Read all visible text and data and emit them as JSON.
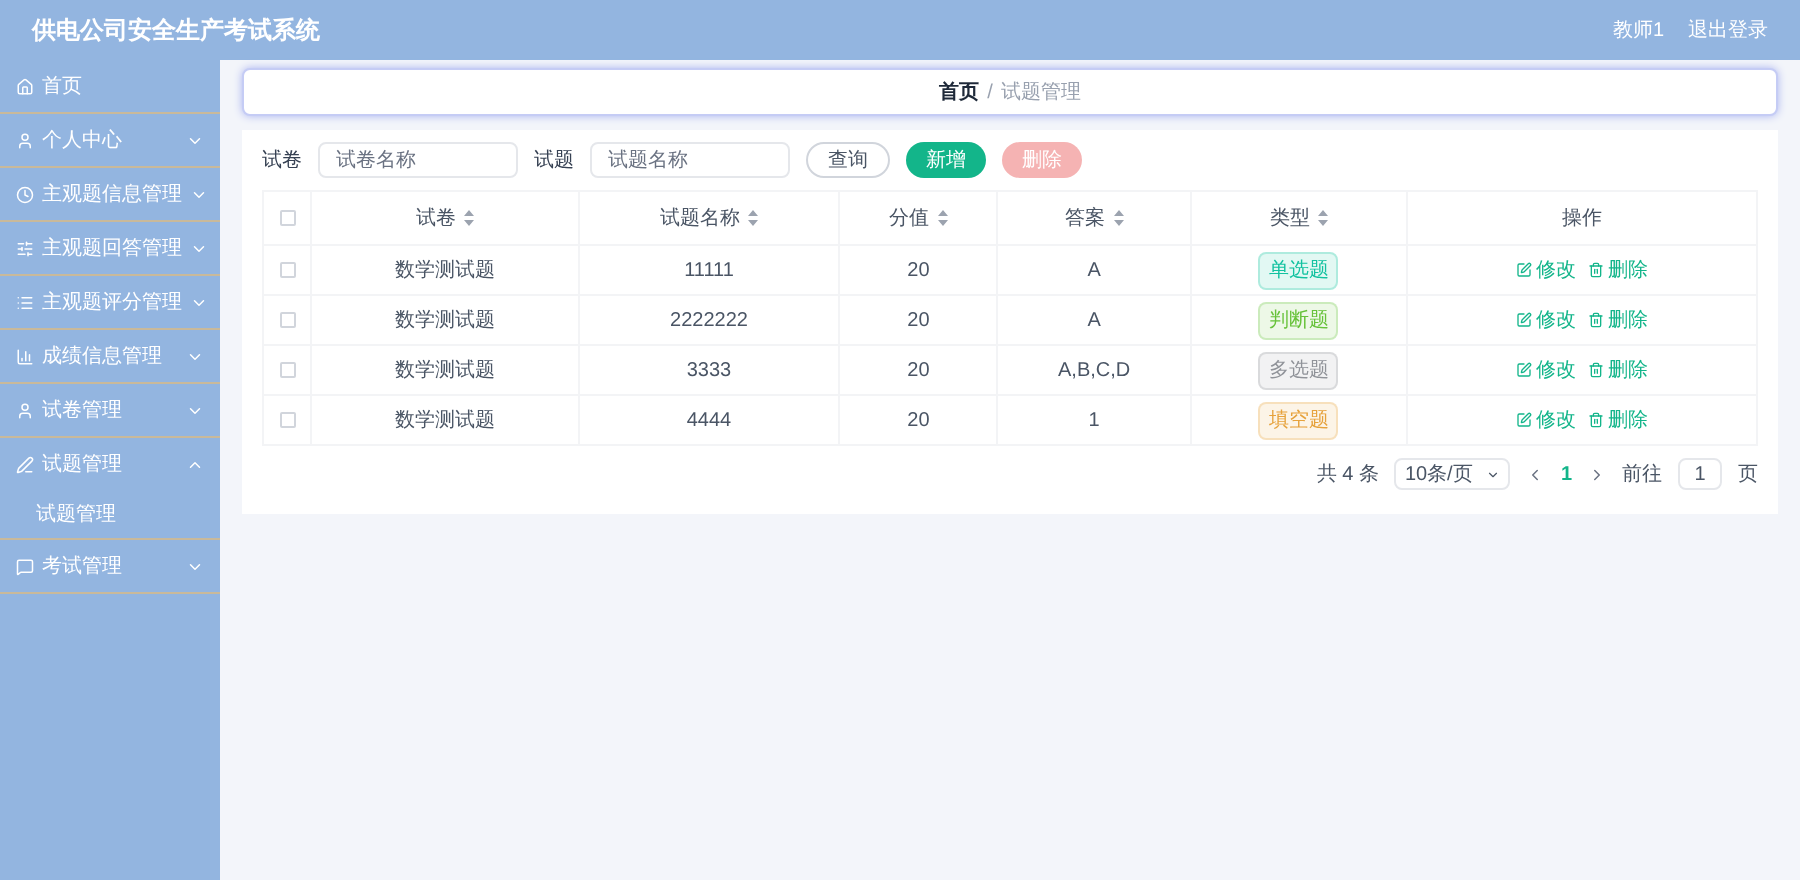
{
  "header": {
    "title": "供电公司安全生产考试系统",
    "user": "教师1",
    "logout": "退出登录"
  },
  "sidebar": {
    "items": [
      {
        "kind": "link",
        "label": "首页"
      },
      {
        "kind": "menu",
        "label": "个人中心",
        "expanded": false
      },
      {
        "kind": "menu",
        "label": "主观题信息管理",
        "expanded": false
      },
      {
        "kind": "menu",
        "label": "主观题回答管理",
        "expanded": false
      },
      {
        "kind": "menu",
        "label": "主观题评分管理",
        "expanded": false
      },
      {
        "kind": "menu",
        "label": "成绩信息管理",
        "expanded": false
      },
      {
        "kind": "menu",
        "label": "试卷管理",
        "expanded": false
      },
      {
        "kind": "menu",
        "label": "试题管理",
        "expanded": true,
        "children": [
          {
            "label": "试题管理"
          }
        ]
      },
      {
        "kind": "menu",
        "label": "考试管理",
        "expanded": false
      }
    ]
  },
  "breadcrumb": [
    "首页",
    "/",
    "试题管理"
  ],
  "search": {
    "fields": [
      {
        "label": "试卷",
        "placeholder": "试卷名称"
      },
      {
        "label": "试题",
        "placeholder": "试题名称"
      }
    ],
    "buttons": [
      {
        "kind": "outline",
        "label": "查询"
      },
      {
        "kind": "primary",
        "label": "新增"
      },
      {
        "kind": "danger",
        "label": "删除"
      }
    ]
  },
  "table": {
    "select_all": {
      "checked": false
    },
    "columns": [
      {
        "label": "试卷",
        "sortable": true
      },
      {
        "label": "试题名称",
        "sortable": true
      },
      {
        "label": "分值",
        "sortable": true
      },
      {
        "label": "答案",
        "sortable": true
      },
      {
        "label": "类型",
        "sortable": true
      },
      {
        "label": "操作",
        "sortable": false
      }
    ],
    "rows": [
      {
        "checked": false,
        "paper": "数学测试题",
        "name": "11111",
        "score": "20",
        "answer": "A",
        "type": {
          "label": "单选题",
          "color": "#13c2a0"
        },
        "actions": [
          "修改",
          "删除"
        ]
      },
      {
        "checked": false,
        "paper": "数学测试题",
        "name": "2222222",
        "score": "20",
        "answer": "A",
        "type": {
          "label": "判断题",
          "color": "#67c23a"
        },
        "actions": [
          "修改",
          "删除"
        ]
      },
      {
        "checked": false,
        "paper": "数学测试题",
        "name": "3333",
        "score": "20",
        "answer": "A,B,C,D",
        "type": {
          "label": "多选题",
          "color": "#909399"
        },
        "actions": [
          "修改",
          "删除"
        ]
      },
      {
        "checked": false,
        "paper": "数学测试题",
        "name": "4444",
        "score": "20",
        "answer": "1",
        "type": {
          "label": "填空题",
          "color": "#e6a23c"
        },
        "actions": [
          "修改",
          "删除"
        ]
      }
    ]
  },
  "pagination": {
    "total": "共 4 条",
    "page_size": "10条/页",
    "pages": [
      {
        "label": "1",
        "selected": true
      }
    ],
    "goto": "前往",
    "page": "1",
    "page_suffix": "页"
  }
}
